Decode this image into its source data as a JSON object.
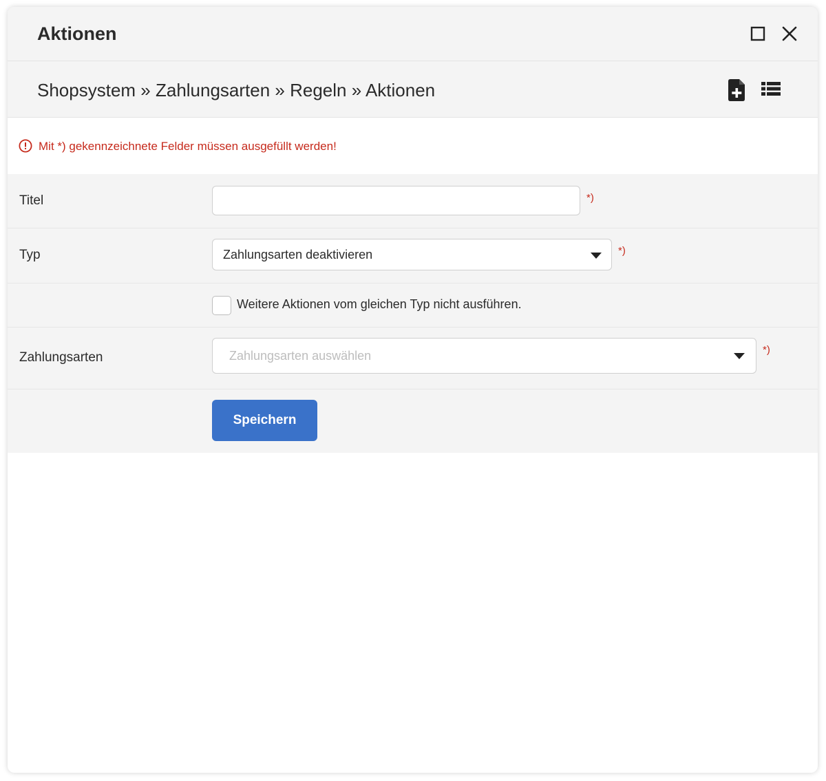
{
  "window": {
    "title": "Aktionen"
  },
  "breadcrumb": {
    "text": "Shopsystem » Zahlungsarten » Regeln » Aktionen"
  },
  "notice": {
    "text": "Mit *) gekennzeichnete Felder müssen ausgefüllt werden!",
    "color": "#c62a1c"
  },
  "form": {
    "titel": {
      "label": "Titel",
      "value": "",
      "required_mark": "*)"
    },
    "typ": {
      "label": "Typ",
      "selected": "Zahlungsarten deaktivieren",
      "required_mark": "*)"
    },
    "checkbox": {
      "label": "Weitere Aktionen vom gleichen Typ nicht ausführen.",
      "checked": false
    },
    "zahlungsarten": {
      "label": "Zahlungsarten",
      "placeholder": "Zahlungsarten auswählen",
      "required_mark": "*)"
    },
    "save_label": "Speichern"
  },
  "colors": {
    "accent": "#3a72c9",
    "error": "#c62a1c",
    "panel_bg": "#f4f4f4"
  },
  "icons": {
    "maximize": "maximize-icon",
    "close": "close-icon",
    "new_document": "file-plus-icon",
    "list": "list-icon",
    "notice": "alert-circle-icon"
  }
}
